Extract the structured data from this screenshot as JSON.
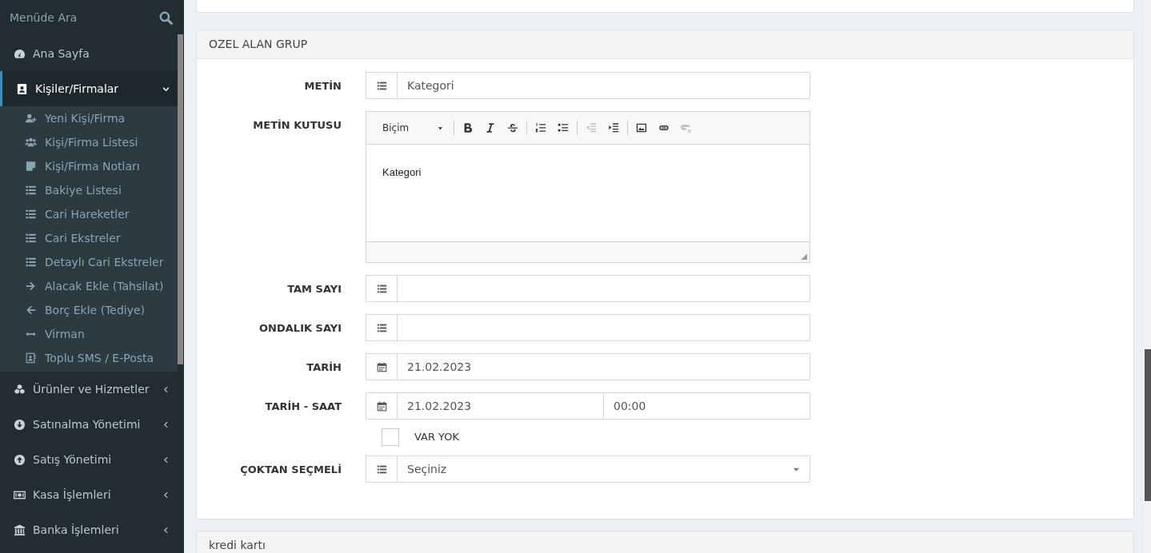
{
  "sidebar": {
    "search": {
      "placeholder": "Menüde Ara"
    },
    "items": [
      {
        "label": "Ana Sayfa",
        "selected": false
      },
      {
        "label": "Kişiler/Firmalar",
        "selected": true,
        "expanded": true,
        "children": [
          {
            "label": "Yeni Kişi/Firma"
          },
          {
            "label": "Kişi/Firma Listesi"
          },
          {
            "label": "Kişi/Firma Notları"
          },
          {
            "label": "Bakiye Listesi"
          },
          {
            "label": "Cari Hareketler"
          },
          {
            "label": "Cari Ekstreler"
          },
          {
            "label": "Detaylı Cari Ekstreler"
          },
          {
            "label": "Alacak Ekle (Tahsilat)"
          },
          {
            "label": "Borç Ekle (Tediye)"
          },
          {
            "label": "Virman"
          },
          {
            "label": "Toplu SMS / E-Posta"
          }
        ]
      },
      {
        "label": "Ürünler ve Hizmetler",
        "selected": false,
        "expanded": false
      },
      {
        "label": "Satınalma Yönetimi",
        "selected": false,
        "expanded": false
      },
      {
        "label": "Satış Yönetimi",
        "selected": false,
        "expanded": false
      },
      {
        "label": "Kasa İşlemleri",
        "selected": false,
        "expanded": false
      },
      {
        "label": "Banka İşlemleri",
        "selected": false,
        "expanded": false
      }
    ]
  },
  "panel": {
    "title": "OZEL ALAN GRUP",
    "fields": [
      {
        "kind": "text",
        "label": "METİN",
        "value": "Kategori"
      },
      {
        "kind": "editor",
        "label": "METİN KUTUSU",
        "format": "Biçim",
        "value": "Kategori"
      },
      {
        "kind": "text",
        "label": "TAM SAYI"
      },
      {
        "kind": "text",
        "label": "ONDALIK SAYI"
      },
      {
        "kind": "date",
        "label": "TARİH",
        "value": "21.02.2023"
      },
      {
        "kind": "datetime",
        "label": "TARİH - SAAT",
        "value": "21.02.2023",
        "time": "00:00"
      },
      {
        "kind": "checkbox",
        "label": "VAR YOK",
        "checked": false
      },
      {
        "kind": "select",
        "label": "ÇOKTAN SEÇMELİ",
        "value": "Seçiniz"
      }
    ]
  },
  "next_panel": {
    "title": "kredi kartı"
  }
}
